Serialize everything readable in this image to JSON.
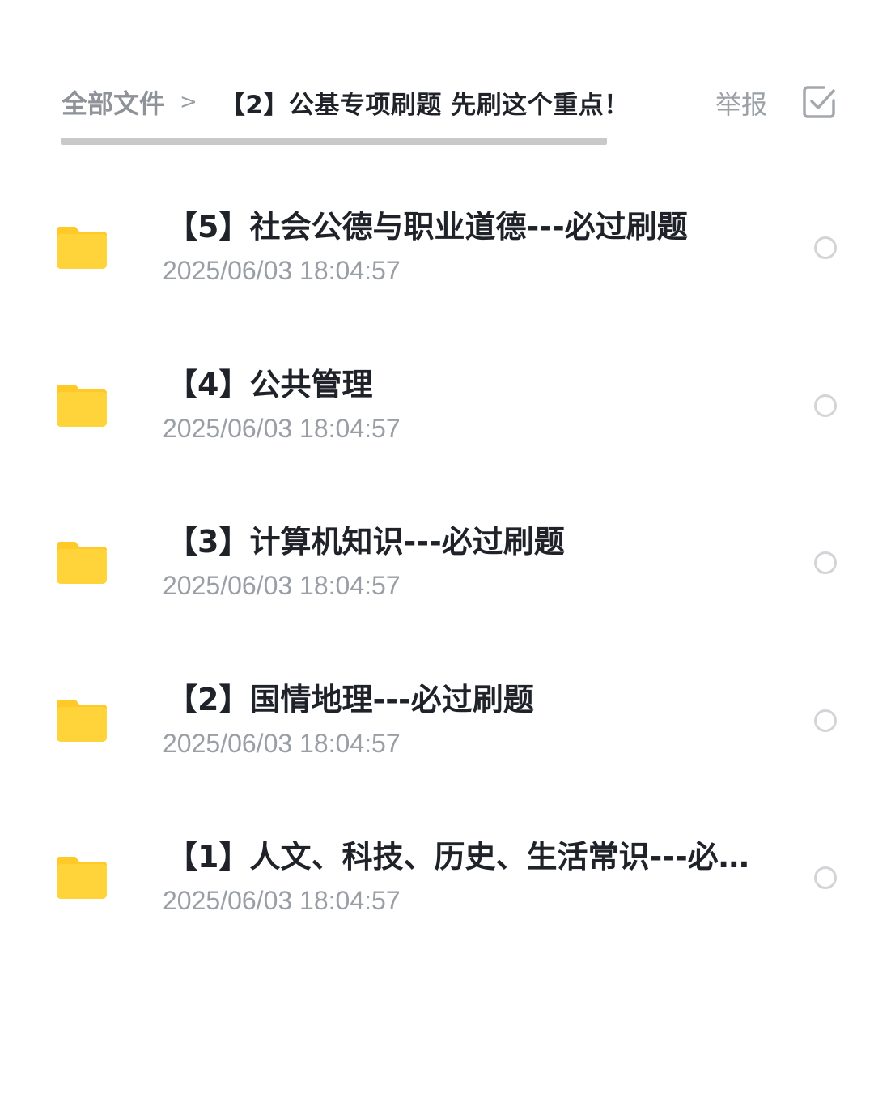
{
  "header": {
    "breadcrumb_root": "全部文件",
    "breadcrumb_separator": ">",
    "breadcrumb_current": "【2】公基专项刷题 先刷这个重点！",
    "report_label": "举报",
    "multiselect_icon": "checkbox-icon"
  },
  "files": [
    {
      "name": "【5】社会公德与职业道德---必过刷题",
      "time": "2025/06/03 18:04:57",
      "icon": "folder-icon"
    },
    {
      "name": "【4】公共管理",
      "time": "2025/06/03 18:04:57",
      "icon": "folder-icon"
    },
    {
      "name": "【3】计算机知识---必过刷题",
      "time": "2025/06/03 18:04:57",
      "icon": "folder-icon"
    },
    {
      "name": "【2】国情地理---必过刷题",
      "time": "2025/06/03 18:04:57",
      "icon": "folder-icon"
    },
    {
      "name": "【1】人文、科技、历史、生活常识---必…",
      "time": "2025/06/03 18:04:57",
      "icon": "folder-icon"
    }
  ],
  "colors": {
    "folder": "#ffd33a",
    "folder_tab": "#ffc928",
    "title_text": "#1f2329",
    "muted_text": "#9a9ea5"
  }
}
